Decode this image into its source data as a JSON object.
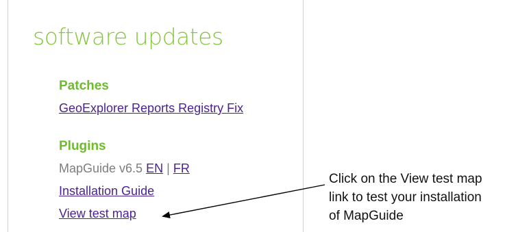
{
  "panel": {
    "title": "software updates",
    "patches": {
      "heading": "Patches",
      "link_label": "GeoExplorer Reports Registry Fix"
    },
    "plugins": {
      "heading": "Plugins",
      "mapguide_label": "MapGuide v6.5",
      "en_link": "EN",
      "separator": "|",
      "fr_link": "FR",
      "installation_guide_link": "Installation Guide",
      "view_test_map_link": "View test map"
    }
  },
  "callout": {
    "lines": [
      "Click on the View test map",
      "link to test your installation",
      "of MapGuide"
    ]
  },
  "colors": {
    "title_green": "#86c63f",
    "heading_green": "#6dbc2a",
    "link_purple": "#4a2390",
    "muted_gray": "#7d7d7d"
  }
}
